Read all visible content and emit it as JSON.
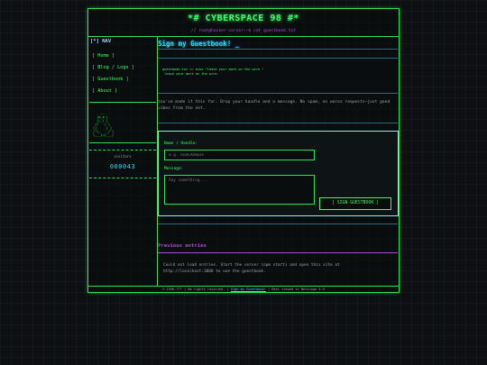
{
  "site": {
    "title": "*# CYBERSPACE 98 #*",
    "breadcrumb": "// root@hacker-corner:~$ cat guestbook.txt"
  },
  "sidebar": {
    "nav_title": "[*] NAV",
    "items": [
      {
        "label": "[ Home ]"
      },
      {
        "label": "[ Blog / Logs ]"
      },
      {
        "label": "[ Guestbook ]"
      },
      {
        "label": "[ About ]"
      }
    ],
    "ascii_art": "   .--.\n  |o_o |\n  |:_/ |\n //   \\ \\\n(|     | )\n/'\\_   _/`\\\n\\___)=(___/",
    "counter_label": "visitors",
    "counter_value": "000043"
  },
  "main": {
    "page_title": "Sign my Guestbook! _",
    "marquee_lines": "guestbook.txt >> echo \"leave your mark on the wire.\"\n leave your mark on the wire.",
    "intro": "You've made it this far. Drop your handle and a message. No spam, no warez requests—just good vibes from the net.",
    "form": {
      "name_label": "Name / Handle:",
      "name_placeholder": "e.g. 0xDEADBEEF",
      "message_label": "Message:",
      "message_placeholder": "Say something...",
      "submit_label": "[ SIGN GUESTBOOK ]"
    },
    "previous_title": "Previous entries",
    "entries_message": "Could not load entries. Start the server (npm start) and open this site at http://localhost:3000 to use the guestbook."
  },
  "footer": {
    "copyright": "© 1996-??? | No rights reserved. |",
    "link": "Sign my Guestbook!",
    "suffix": "| Best viewed in Netscape 4.0"
  },
  "colors": {
    "accent_green": "#3cff6a",
    "accent_cyan": "#33d9ff",
    "accent_purple": "#b04ad8",
    "background": "#0d0f12"
  }
}
